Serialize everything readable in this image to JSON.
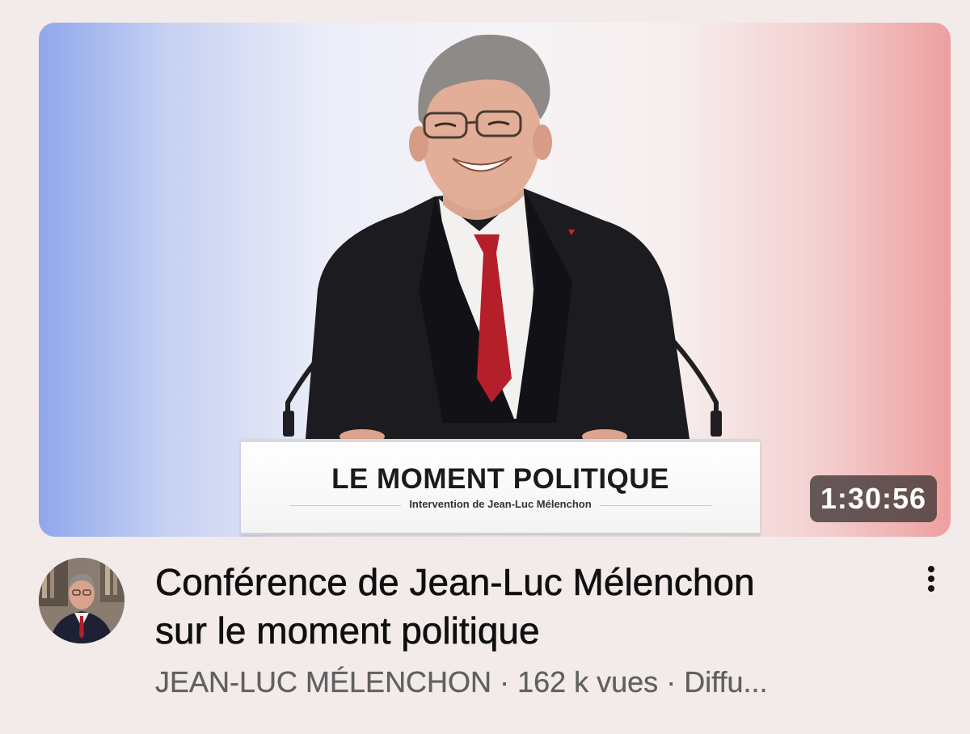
{
  "video": {
    "thumbnail": {
      "podium_title": "LE MOMENT POLITIQUE",
      "podium_subtitle": "Intervention de Jean-Luc Mélenchon",
      "duration": "1:30:56",
      "background_colors": [
        "#8fa8ec",
        "#f6f4f6",
        "#ee9f9f"
      ]
    },
    "title_line_1": "Conférence de Jean-Luc Mélenchon",
    "title_line_2": "sur le moment politique",
    "channel_name": "JEAN-LUC MÉLENCHON",
    "separator": "·",
    "views": "162 k vues",
    "status": "Diffu...",
    "menu_icon": "more-vert-icon",
    "avatar_icon": "channel-avatar"
  }
}
